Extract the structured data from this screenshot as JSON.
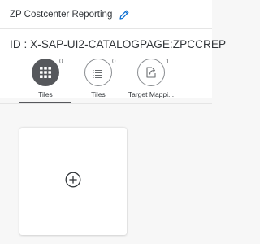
{
  "header": {
    "title": "ZP Costcenter Reporting",
    "edit_icon": "pencil-icon",
    "id_text": "ID : X-SAP-UI2-CATALOGPAGE:ZPCCREP"
  },
  "tabs": [
    {
      "label": "Tiles",
      "count": "0",
      "icon": "grid-icon",
      "selected": true
    },
    {
      "label": "Tiles",
      "count": "0",
      "icon": "list-icon",
      "selected": false
    },
    {
      "label": "Target Mappi...",
      "count": "1",
      "icon": "share-icon",
      "selected": false
    }
  ],
  "add_tile": {
    "icon": "add-circle-icon"
  },
  "colors": {
    "accent": "#56585c",
    "background": "#f7f7f7",
    "surface": "#ffffff",
    "edit_icon": "#0a6ed1"
  }
}
